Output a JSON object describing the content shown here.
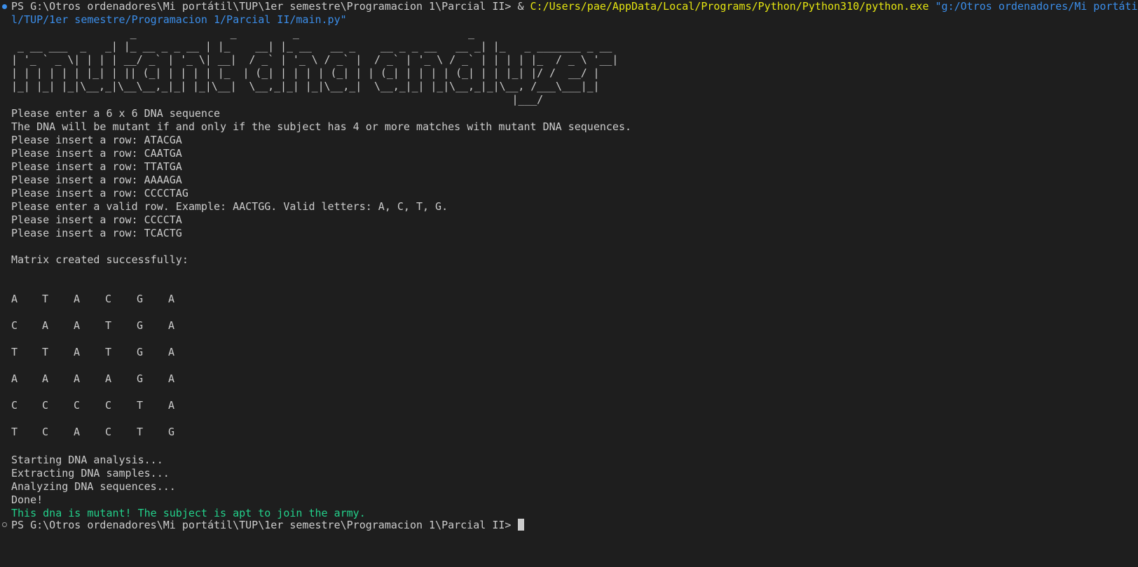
{
  "prompt": {
    "path": "PS G:\\Otros ordenadores\\Mi portátil\\TUP\\1er semestre\\Programacion 1\\Parcial II>",
    "operator": " & ",
    "python_exe": "C:/Users/pae/AppData/Local/Programs/Python/Python310/python.exe",
    "script_arg_line1": " \"g:/Otros ordenadores/Mi portáti",
    "script_arg_line2": "l/TUP/1er semestre/Programacion 1/Parcial II/main.py\""
  },
  "banner": [
    "                   _               _         _                           _                       ",
    " _ __ ___  _   _| |_ __ _ _ __ | |_    __| |_ __   __ _    __ _ _ __   __ _| |_   _ _______ _ __ ",
    "| '_ ` _ \\| | | | __/ _` | '_ \\| __|  / _` | '_ \\ / _` |  / _` | '_ \\ / _` | | | | |_  / _ \\ '__|",
    "| | | | | | |_| | || (_| | | | | |_  | (_| | | | | (_| | | (_| | | | | (_| | | |_| |/ /  __/ |   ",
    "|_| |_| |_|\\__,_|\\__\\__,_|_| |_|\\__|  \\__,_|_| |_|\\__,_|  \\__,_|_| |_|\\__,_|_|\\__, /___\\___|_|   ",
    "                                                                                |___/              "
  ],
  "messages": {
    "enter_sequence": "Please enter a 6 x 6 DNA sequence",
    "rule": "The DNA will be mutant if and only if the subject has 4 or more matches with mutant DNA sequences.",
    "inputs": [
      "Please insert a row: ATACGA",
      "Please insert a row: CAATGA",
      "Please insert a row: TTATGA",
      "Please insert a row: AAAAGA",
      "Please insert a row: CCCCTAG",
      "Please enter a valid row. Example: AACTGG. Valid letters: A, C, T, G.",
      "Please insert a row: CCCCTA",
      "Please insert a row: TCACTG"
    ],
    "matrix_created": "Matrix created successfully:",
    "analysis": [
      "Starting DNA analysis...",
      "Extracting DNA samples...",
      "Analyzing DNA sequences...",
      "Done!"
    ],
    "result": "This dna is mutant! The subject is apt to join the army."
  },
  "matrix": [
    [
      "A",
      "T",
      "A",
      "C",
      "G",
      "A"
    ],
    [
      "C",
      "A",
      "A",
      "T",
      "G",
      "A"
    ],
    [
      "T",
      "T",
      "A",
      "T",
      "G",
      "A"
    ],
    [
      "A",
      "A",
      "A",
      "A",
      "G",
      "A"
    ],
    [
      "C",
      "C",
      "C",
      "C",
      "T",
      "A"
    ],
    [
      "T",
      "C",
      "A",
      "C",
      "T",
      "G"
    ]
  ],
  "final_prompt": "PS G:\\Otros ordenadores\\Mi portátil\\TUP\\1er semestre\\Programacion 1\\Parcial II> ",
  "colors": {
    "background": "#1e1e1e",
    "text": "#cccccc",
    "command": "#e5e510",
    "argument": "#3b8eea",
    "success": "#23d18b"
  }
}
